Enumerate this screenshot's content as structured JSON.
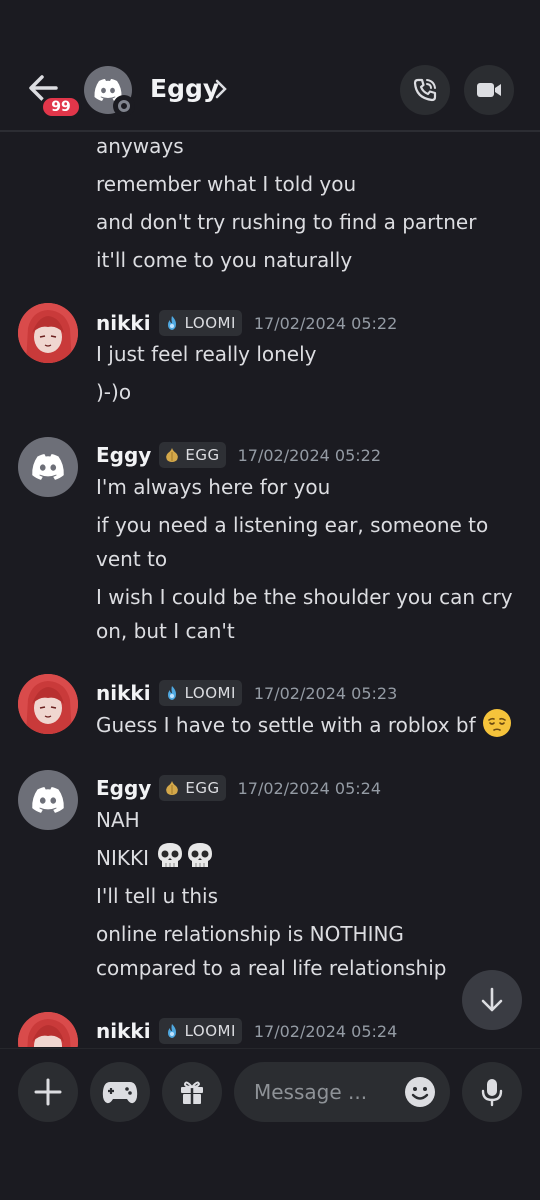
{
  "header": {
    "title": "Eggy",
    "unread_count": "99"
  },
  "messages": [
    {
      "continuation": true,
      "lines": [
        "anyways",
        "remember what I told you",
        "and don't try rushing to find a partner",
        "it'll come to you naturally"
      ]
    },
    {
      "author": "nikki",
      "tag": "LOOMI",
      "timestamp": "17/02/2024 05:22",
      "lines": [
        "I just feel really lonely",
        ")-)o"
      ]
    },
    {
      "author": "Eggy",
      "tag": "EGG",
      "timestamp": "17/02/2024 05:22",
      "lines": [
        "I'm always here for you",
        "if you need a listening ear, someone to",
        "vent to",
        "I wish I could be the shoulder you can cry",
        "on, but I can't"
      ]
    },
    {
      "author": "nikki",
      "tag": "LOOMI",
      "timestamp": "17/02/2024 05:23",
      "lines": [
        "Guess I have to settle with a roblox bf"
      ]
    },
    {
      "author": "Eggy",
      "tag": "EGG",
      "timestamp": "17/02/2024 05:24",
      "lines": [
        "NAH",
        "NIKKI",
        "I'll tell u this",
        "online relationship is NOTHING",
        "compared to a real life relationship"
      ]
    },
    {
      "author": "nikki",
      "tag": "LOOMI",
      "timestamp": "17/02/2024 05:24",
      "lines": []
    }
  ],
  "composer": {
    "placeholder": "Message ..."
  },
  "icons": {
    "back": "arrow-left-icon",
    "call": "phone-call-icon",
    "video": "video-camera-icon",
    "add": "plus-icon",
    "games": "gamepad-icon",
    "gift": "gift-icon",
    "emoji": "smiley-icon",
    "mic": "microphone-icon",
    "scroll": "arrow-down-icon"
  },
  "colors": {
    "background": "#1b1b21",
    "badge": "#e1364a",
    "loomi_tag": "#4fa8e0",
    "egg_tag": "#d4a84a"
  }
}
